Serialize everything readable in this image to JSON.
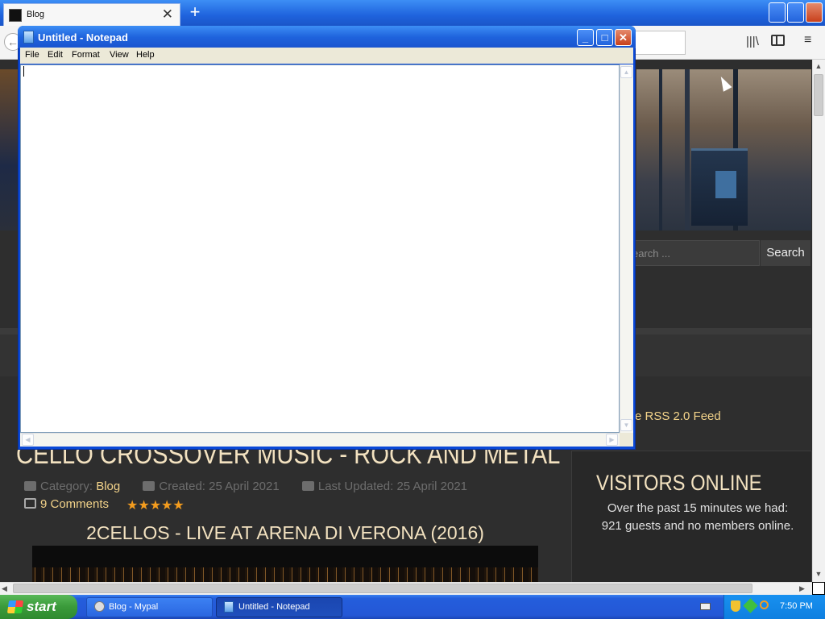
{
  "browser": {
    "tab_title": "Blog",
    "new_tab_symbol": "+",
    "tab_close_symbol": "✕",
    "toolbar": {
      "back_symbol": "←",
      "library_symbol": "|||\\",
      "menu_symbol": "≡"
    }
  },
  "website": {
    "search": {
      "placeholder": "earch ...",
      "button_label": "Search"
    },
    "rss_link": "e RSS 2.0 Feed",
    "article": {
      "title": "CELLO CROSSOVER MUSIC - ROCK AND METAL",
      "category_label": "Category:",
      "category_value": "Blog",
      "created": "Created: 25 April 2021",
      "updated": "Last Updated: 25 April 2021",
      "comments": "9 Comments",
      "rating_stars": "★★★★★",
      "rating": 5,
      "video_title": "2CELLOS - LIVE AT ARENA DI VERONA (2016)"
    },
    "visitors": {
      "title": "VISITORS ONLINE",
      "text": "Over the past 15 minutes we had: 921 guests and no members online."
    }
  },
  "notepad": {
    "title": "Untitled - Notepad",
    "menu": [
      "File",
      "Edit",
      "Format",
      "View",
      "Help"
    ],
    "content": ""
  },
  "taskbar": {
    "start_label": "start",
    "tasks": [
      {
        "label": "Blog - Mypal",
        "icon": "browser-icon",
        "active": false
      },
      {
        "label": "Untitled - Notepad",
        "icon": "notepad-icon",
        "active": true
      }
    ],
    "clock": "7:50 PM"
  },
  "colors": {
    "xp_blue": "#245edc",
    "page_bg": "#2e2e2e",
    "accent_link": "#f3d38a",
    "heading": "#f3e2c0",
    "stars": "#f39c1e"
  }
}
